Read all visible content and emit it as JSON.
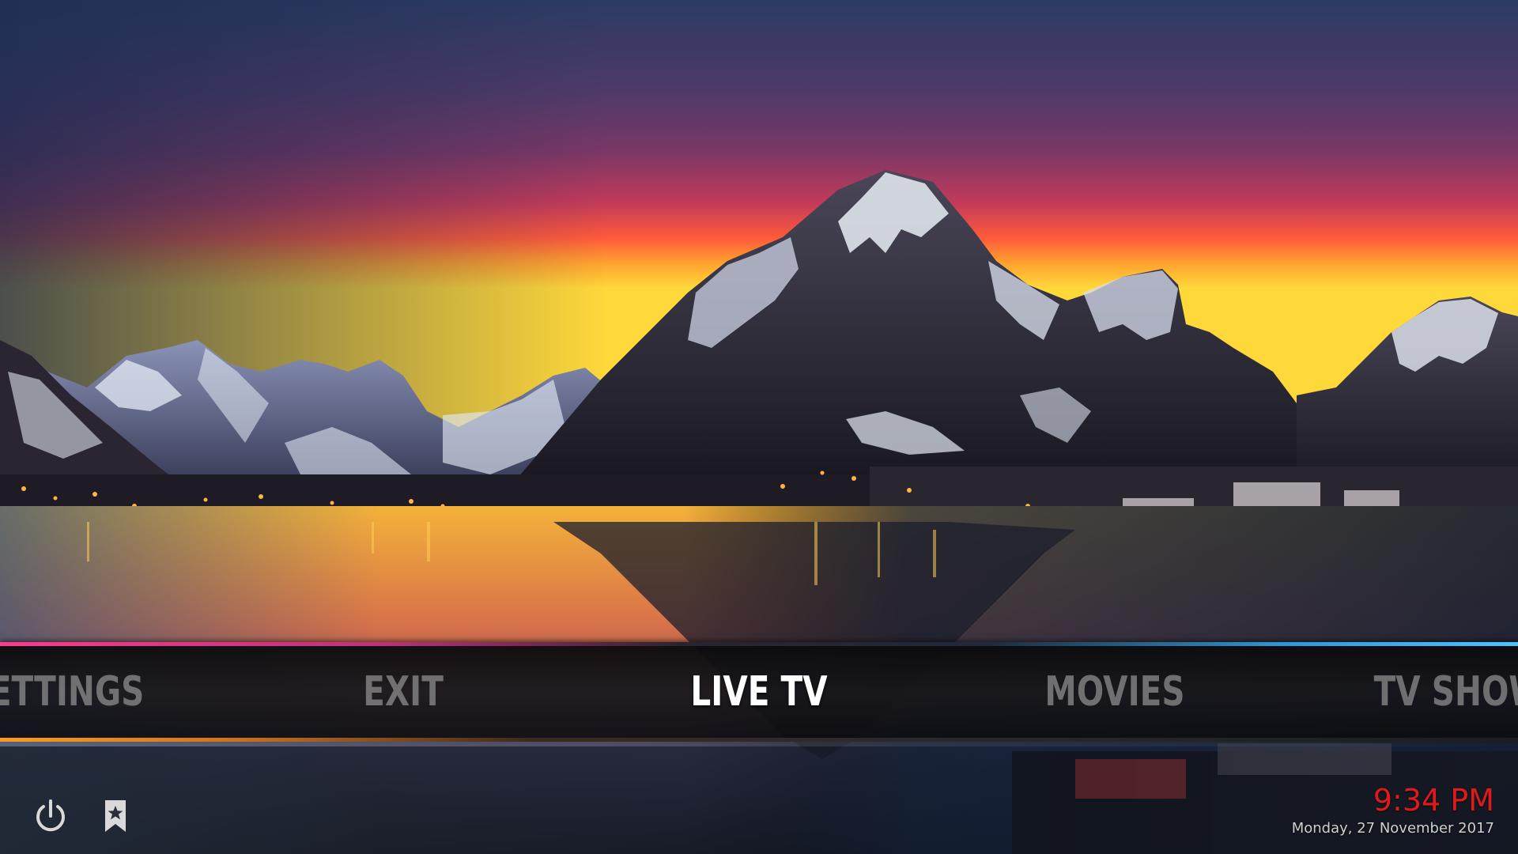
{
  "menu": {
    "items": [
      {
        "label": "SETTINGS",
        "active": false
      },
      {
        "label": "EXIT",
        "active": false
      },
      {
        "label": "LIVE TV",
        "active": true
      },
      {
        "label": "MOVIES",
        "active": false
      },
      {
        "label": "TV SHOWS",
        "active": false
      }
    ]
  },
  "footer": {
    "power_icon": "power-icon",
    "favourites_icon": "favourites-star-icon"
  },
  "clock": {
    "time": "9:34 PM",
    "date": "Monday, 27 November 2017"
  },
  "colors": {
    "accent_left": "#ff3a8f",
    "accent_right": "#4cc3ff",
    "accent_bottom": "#ff9a1e",
    "clock_time": "#e01a1a",
    "active_text": "#ffffff"
  }
}
